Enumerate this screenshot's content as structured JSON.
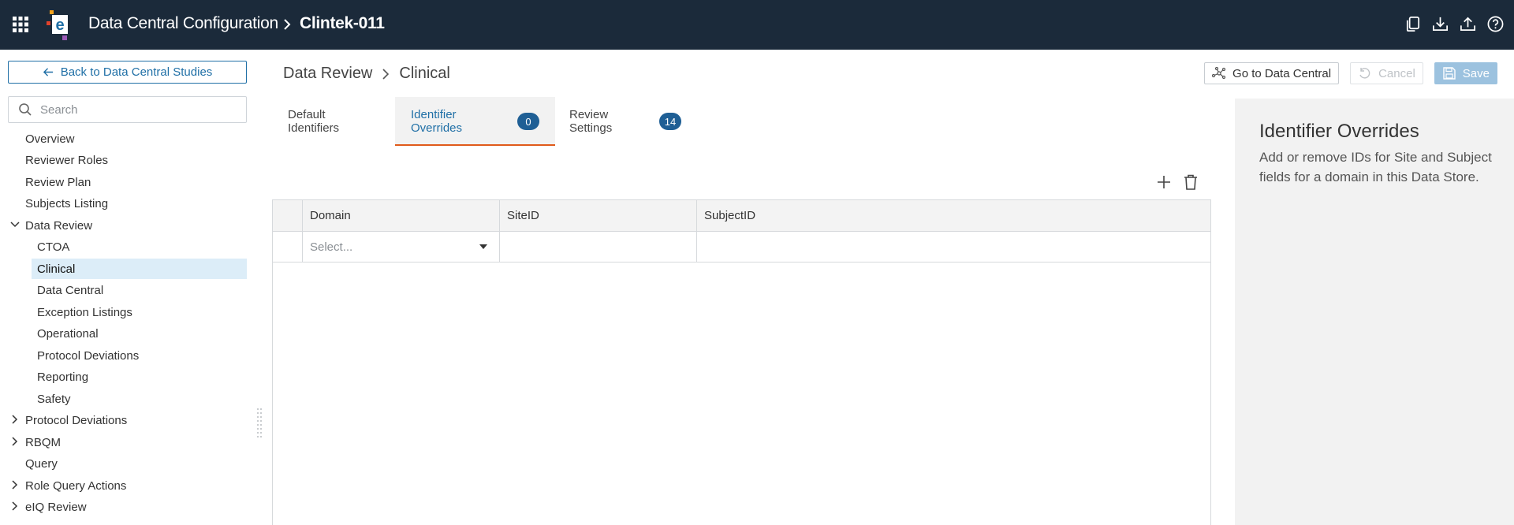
{
  "topbar": {
    "app_title": "Data Central Configuration",
    "study": "Clintek-011",
    "icons": [
      "apps-grid-icon",
      "logo",
      "copy-icon",
      "download-icon",
      "upload-icon",
      "help-icon"
    ],
    "bg_color": "#1b2a3a"
  },
  "sidebar": {
    "back_label": "Back to Data Central Studies",
    "search_placeholder": "Search",
    "items": [
      {
        "label": "Overview"
      },
      {
        "label": "Reviewer Roles"
      },
      {
        "label": "Review Plan"
      },
      {
        "label": "Subjects Listing"
      },
      {
        "label": "Data Review",
        "expanded": true
      },
      {
        "label": "CTOA"
      },
      {
        "label": "Clinical",
        "selected": true
      },
      {
        "label": "Data Central"
      },
      {
        "label": "Exception Listings"
      },
      {
        "label": "Operational"
      },
      {
        "label": "Protocol Deviations"
      },
      {
        "label": "Reporting"
      },
      {
        "label": "Safety"
      },
      {
        "label": "Protocol Deviations",
        "expanded": false
      },
      {
        "label": "RBQM",
        "expanded": false
      },
      {
        "label": "Query"
      },
      {
        "label": "Role Query Actions",
        "expanded": false
      },
      {
        "label": "eIQ Review",
        "expanded": false
      }
    ]
  },
  "main": {
    "breadcrumb": {
      "parent": "Data Review",
      "current": "Clinical"
    },
    "buttons": {
      "go_to": "Go to Data Central",
      "cancel": "Cancel",
      "save": "Save"
    },
    "tabs": [
      {
        "label": "Default Identifiers"
      },
      {
        "label": "Identifier Overrides",
        "count": "0",
        "active": true
      },
      {
        "label": "Review Settings",
        "count": "14"
      }
    ],
    "grid": {
      "columns": [
        "Domain",
        "SiteID",
        "SubjectID"
      ],
      "row": {
        "domain_placeholder": "Select...",
        "site_id": "",
        "subject_id": ""
      }
    }
  },
  "help": {
    "title": "Identifier Overrides",
    "body": "Add or remove IDs for Site and Subject fields for a domain in this Data Store."
  },
  "colors": {
    "accent": "#1f6fa6",
    "tab_underline": "#e05a1a",
    "badge": "#1f5f95",
    "selected_bg": "#dcedf8"
  }
}
